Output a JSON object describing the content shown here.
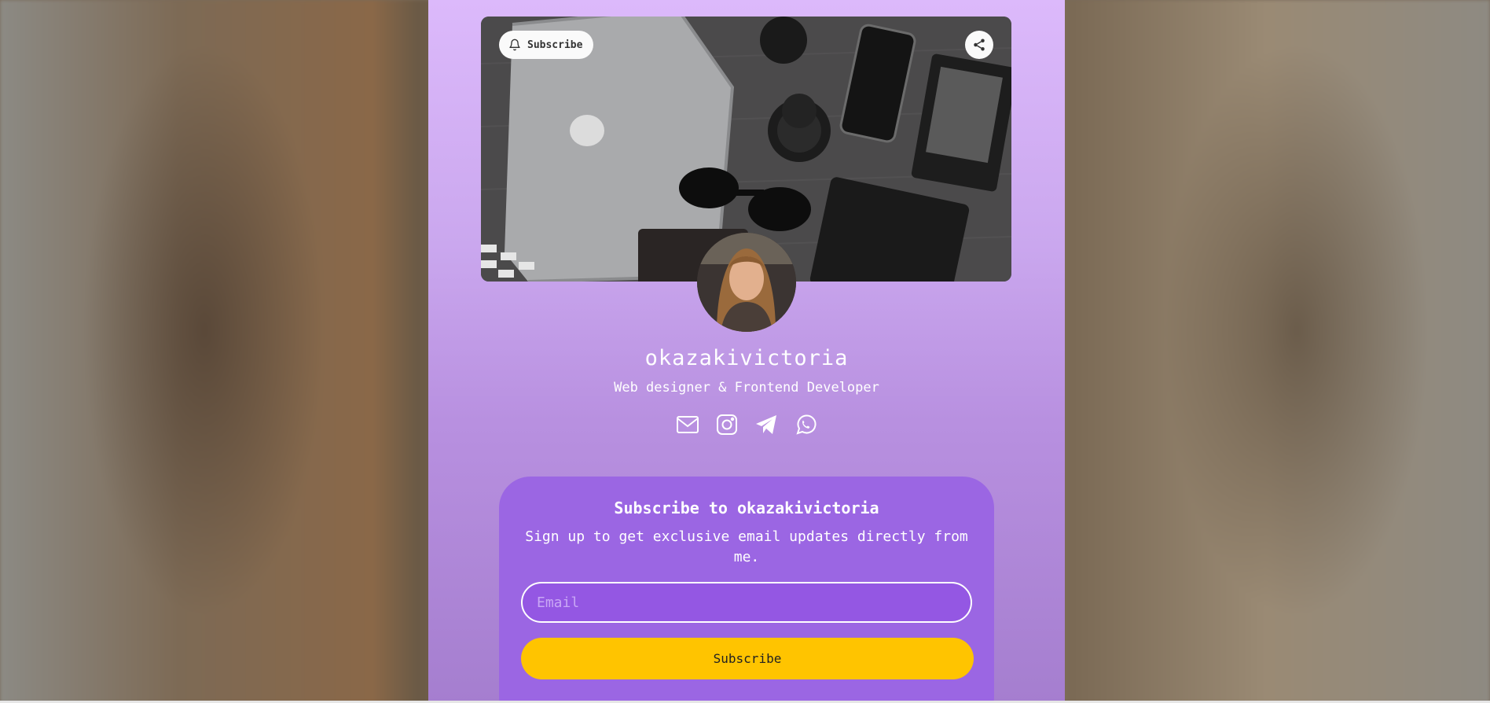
{
  "profile": {
    "username": "okazakivictoria",
    "tagline": "Web designer & Frontend Developer"
  },
  "header": {
    "subscribe_label": "Subscribe",
    "bell_icon": "bell-icon",
    "share_icon": "share-icon"
  },
  "socials": [
    {
      "icon": "email-icon"
    },
    {
      "icon": "instagram-icon"
    },
    {
      "icon": "telegram-icon"
    },
    {
      "icon": "whatsapp-icon"
    }
  ],
  "subscribe_card": {
    "title": "Subscribe to okazakivictoria",
    "description": "Sign up to get exclusive email updates directly from me.",
    "email_placeholder": "Email",
    "email_value": "",
    "button_label": "Subscribe"
  },
  "colors": {
    "card": "#9b66e3",
    "button": "#ffc400",
    "column_top": "#dcb9fb",
    "column_bottom": "#a57ecf"
  }
}
